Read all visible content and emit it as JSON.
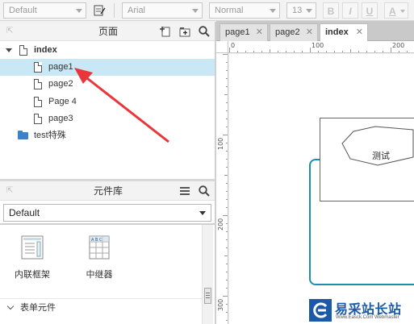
{
  "toolbar": {
    "style_value": "Default",
    "font_value": "Arial",
    "weight_value": "Normal",
    "size_value": "13",
    "bold_label": "B",
    "italic_label": "I",
    "underline_label": "U",
    "font_color_label": "A"
  },
  "pages_panel": {
    "title": "页面",
    "tree": [
      {
        "label": "index",
        "type": "page",
        "level": 0,
        "expanded": true,
        "bold": true
      },
      {
        "label": "page1",
        "type": "page",
        "level": 1,
        "selected": true
      },
      {
        "label": "page2",
        "type": "page",
        "level": 1
      },
      {
        "label": "Page 4",
        "type": "page",
        "level": 1
      },
      {
        "label": "page3",
        "type": "page",
        "level": 1
      },
      {
        "label": "test特殊",
        "type": "folder",
        "level": 0
      }
    ]
  },
  "library_panel": {
    "title": "元件库",
    "selected_library": "Default",
    "widgets": [
      {
        "label": "内联框架",
        "icon": "inline-frame-icon"
      },
      {
        "label": "中继器",
        "icon": "repeater-icon"
      }
    ],
    "section_label": "表单元件"
  },
  "tabs": [
    {
      "label": "page1",
      "active": false
    },
    {
      "label": "page2",
      "active": false
    },
    {
      "label": "index",
      "active": true
    }
  ],
  "ruler": {
    "h_labels": [
      "0",
      "100",
      "200"
    ],
    "v_labels": [
      "100",
      "200",
      "300"
    ]
  },
  "canvas": {
    "shape_text": "测试",
    "panel_border_color": "#1d8fa8"
  },
  "annotation": {
    "color": "#e8363a"
  },
  "watermark": {
    "text": "易采站长站",
    "subtext": "Www.Easck.Com Webmaster"
  }
}
